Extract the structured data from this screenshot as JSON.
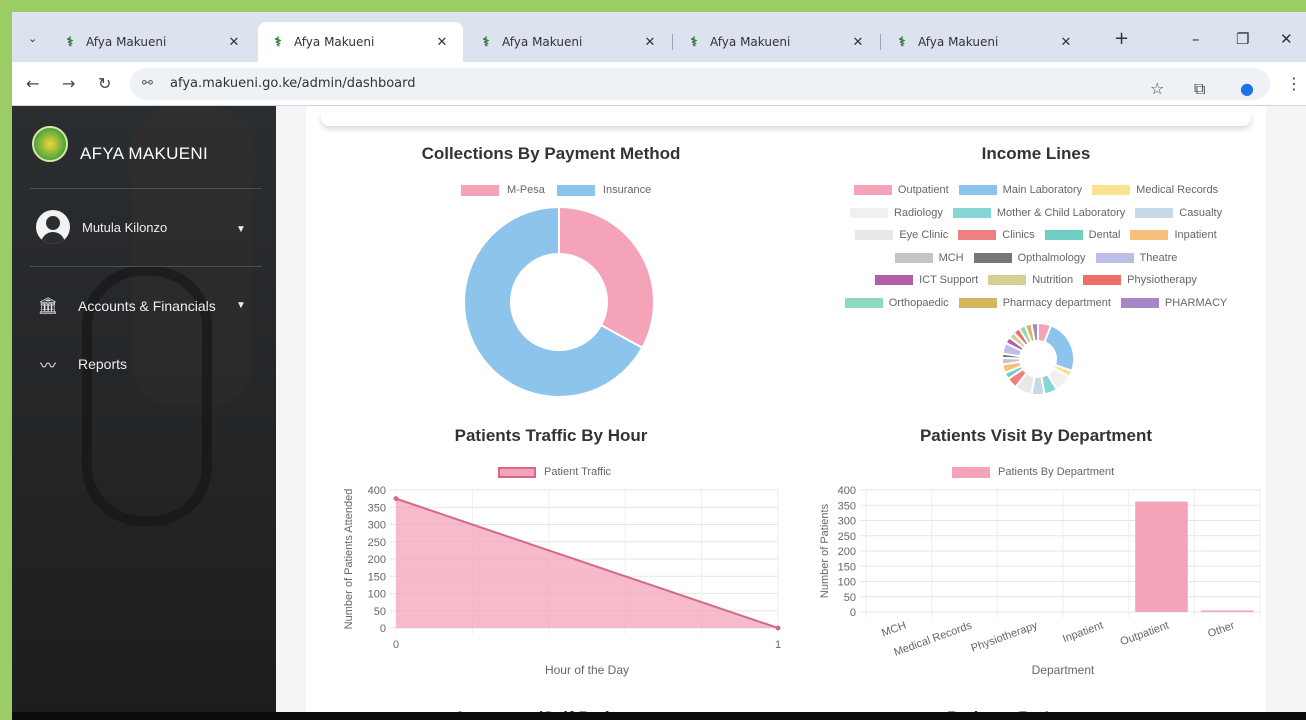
{
  "browser": {
    "tabs": [
      {
        "title": "Afya Makueni",
        "active": false
      },
      {
        "title": "Afya Makueni",
        "active": true
      },
      {
        "title": "Afya Makueni",
        "active": false
      },
      {
        "title": "Afya Makueni",
        "active": false
      },
      {
        "title": "Afya Makueni",
        "active": false
      }
    ],
    "url": "afya.makueni.go.ke/admin/dashboard"
  },
  "sidebar": {
    "brand": "AFYA MAKUENI",
    "user": "Mutula Kilonzo",
    "items": [
      {
        "label": "Accounts & Financials",
        "icon": "bank-icon"
      },
      {
        "label": "Reports",
        "icon": "chart-line-icon"
      }
    ]
  },
  "colors": {
    "pink": "#f4a3b8",
    "blue": "#8cc4ec"
  },
  "chart_data": [
    {
      "type": "pie",
      "title": "Collections By Payment Method",
      "series": [
        {
          "name": "M-Pesa",
          "value": 33,
          "color": "#f4a3b8"
        },
        {
          "name": "Insurance",
          "value": 67,
          "color": "#8cc4ec"
        }
      ],
      "legend": "top"
    },
    {
      "type": "pie",
      "title": "Income Lines",
      "legend": "top",
      "series": [
        {
          "name": "Outpatient",
          "value": 6,
          "color": "#f4a3b8"
        },
        {
          "name": "Main Laboratory",
          "value": 25,
          "color": "#8cc4ec"
        },
        {
          "name": "Medical Records",
          "value": 3,
          "color": "#fbe28f"
        },
        {
          "name": "Radiology",
          "value": 8,
          "color": "#f0f0f0"
        },
        {
          "name": "Mother & Child Laboratory",
          "value": 6,
          "color": "#86d6d6"
        },
        {
          "name": "Casualty",
          "value": 6,
          "color": "#c7d8e6"
        },
        {
          "name": "Eye Clinic",
          "value": 8,
          "color": "#e8e8e8"
        },
        {
          "name": "Clinics",
          "value": 5,
          "color": "#f08080"
        },
        {
          "name": "Dental",
          "value": 3,
          "color": "#6fcfc4"
        },
        {
          "name": "Inpatient",
          "value": 4,
          "color": "#f7c07c"
        },
        {
          "name": "MCH",
          "value": 3,
          "color": "#c4c4c4"
        },
        {
          "name": "Opthalmology",
          "value": 2,
          "color": "#777777"
        },
        {
          "name": "Theatre",
          "value": 5,
          "color": "#bdbde6"
        },
        {
          "name": "ICT Support",
          "value": 3,
          "color": "#b15fa8"
        },
        {
          "name": "Nutrition",
          "value": 3,
          "color": "#d4cf94"
        },
        {
          "name": "Physiotherapy",
          "value": 3,
          "color": "#ec7063"
        },
        {
          "name": "Orthopaedic",
          "value": 3,
          "color": "#8ed9c0"
        },
        {
          "name": "Pharmacy department",
          "value": 3,
          "color": "#d4b65e"
        },
        {
          "name": "PHARMACY",
          "value": 3,
          "color": "#a788c7"
        }
      ]
    },
    {
      "type": "area",
      "title": "Patients Traffic By Hour",
      "xlabel": "Hour of the Day",
      "ylabel": "Number of Patients Attended",
      "x": [
        0,
        1
      ],
      "series": [
        {
          "name": "Patient Traffic",
          "values": [
            375,
            0
          ]
        }
      ],
      "ylim": [
        0,
        400
      ],
      "yticks": [
        0,
        50,
        100,
        150,
        200,
        250,
        300,
        350,
        400
      ],
      "xticks": [
        "0",
        "1"
      ],
      "grid": true,
      "legend": "top"
    },
    {
      "type": "bar",
      "title": "Patients Visit By Department",
      "xlabel": "Department",
      "ylabel": "Number of Patients",
      "categories": [
        "MCH",
        "Medical Records",
        "Physiotherapy",
        "Inpatient",
        "Outpatient",
        "Other"
      ],
      "series": [
        {
          "name": "Patients By Department",
          "values": [
            0,
            0,
            0,
            0,
            362,
            5
          ]
        }
      ],
      "ylim": [
        0,
        400
      ],
      "yticks": [
        0,
        50,
        100,
        150,
        200,
        250,
        300,
        350,
        400
      ],
      "grid": true,
      "legend": "top"
    }
  ],
  "lower_titles": {
    "left": "Insurance/Self Patients",
    "right": "Patients By Insurance"
  }
}
